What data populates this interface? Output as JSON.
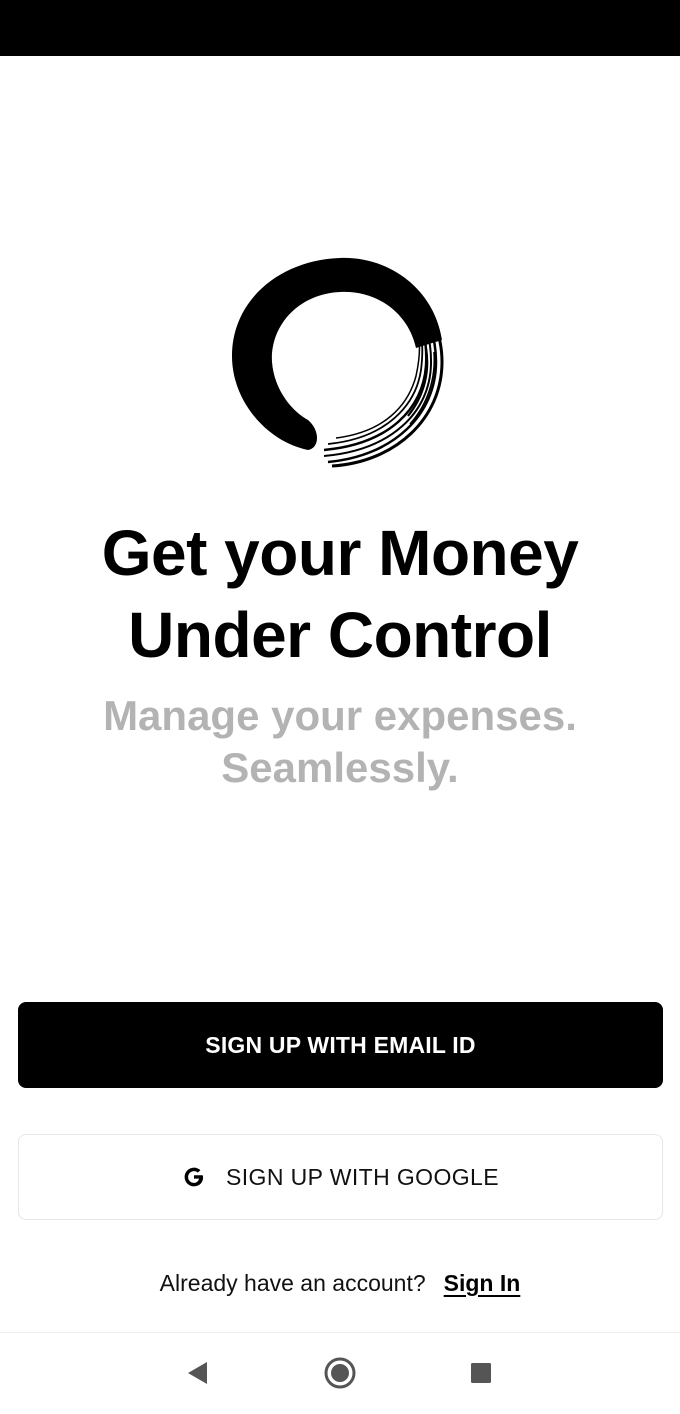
{
  "app": {
    "headline": [
      "Get your Money",
      "Under Control"
    ],
    "subline": [
      "Manage your expenses.",
      "Seamlessly."
    ]
  },
  "actions": {
    "email_signup_label": "SIGN UP WITH EMAIL ID",
    "google_signup_label": "SIGN UP WITH GOOGLE",
    "google_icon": "google-g-icon"
  },
  "signin": {
    "prompt": "Already have an account?",
    "link_label": "Sign In"
  },
  "navigation": {
    "back_icon": "triangle-back-icon",
    "home_icon": "circle-home-icon",
    "recents_icon": "square-recents-icon"
  },
  "colors": {
    "primary": "#000000",
    "subtitle": "#b3b3b3",
    "background": "#ffffff",
    "nav_icon": "#555555"
  }
}
